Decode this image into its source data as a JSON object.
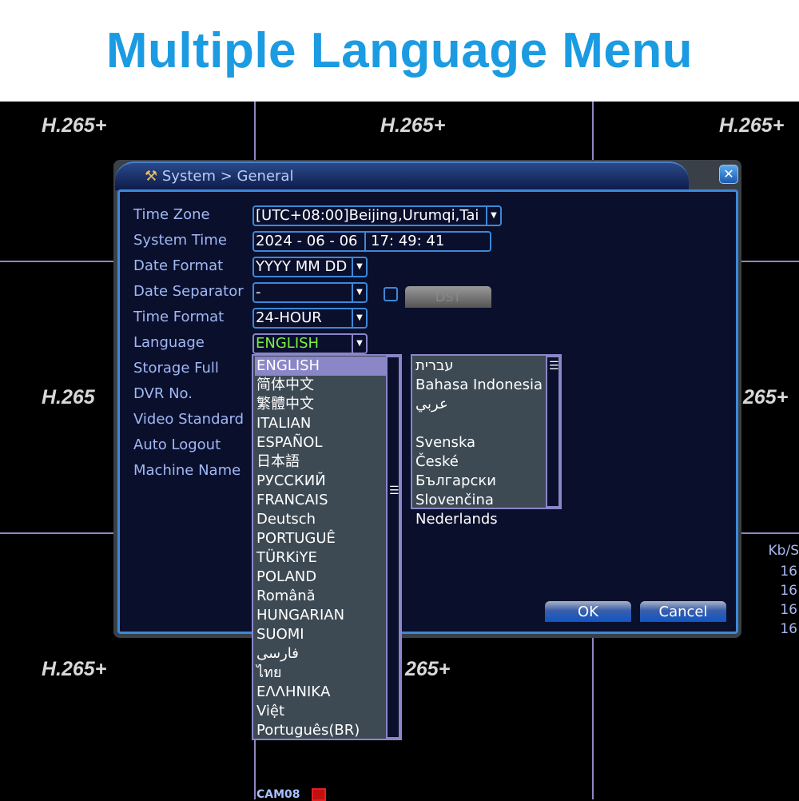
{
  "header": {
    "title": "Multiple Language Menu"
  },
  "background": {
    "codec_label": "H.265+",
    "codec_label_partial": "265+",
    "codec_label_nsplus": "H.265",
    "kbs_header": "Kb/S",
    "kbs_values": [
      "16",
      "16",
      "16",
      "16"
    ],
    "camera_label": "CAM08"
  },
  "dialog": {
    "title": "System > General",
    "close_icon": "close-x-icon",
    "labels": [
      "Time Zone",
      "System Time",
      "Date Format",
      "Date Separator",
      "Time Format",
      "Language",
      "Storage Full",
      "DVR No.",
      "Video Standard",
      "Auto Logout",
      "Machine Name"
    ],
    "time_zone": "[UTC+08:00]Beijing,Urumqi,Tai",
    "system_date": "2024 - 06 - 06",
    "system_time": "17: 49: 41",
    "date_format": "YYYY MM DD",
    "dst_label": "DST",
    "date_separator": "-",
    "time_format": "24-HOUR",
    "language": "ENGLISH",
    "ok_label": "OK",
    "cancel_label": "Cancel"
  },
  "language_list": {
    "selected": "ENGLISH",
    "left": [
      "ENGLISH",
      "简体中文",
      "繁體中文",
      "ITALIAN",
      "ESPAÑOL",
      "日本語",
      "РУССКИЙ",
      "FRANCAIS",
      "Deutsch",
      "PORTUGUÊ",
      "TÜRKiYE",
      "POLAND",
      "Română",
      "HUNGARIAN",
      "SUOMI",
      "فارسی",
      "ไทย",
      "ΕΛΛΗΝΙΚΑ",
      "Việt",
      "Português(BR)"
    ],
    "right": [
      "עברית",
      "Bahasa Indonesia",
      "عربي",
      "",
      "Svenska",
      "České",
      "Български",
      "Slovenčina",
      "Nederlands"
    ]
  },
  "colors": {
    "title_blue": "#1a9be2",
    "selection": "#8a86c8",
    "language_value": "#7cf040",
    "border": "#3d88d8"
  }
}
